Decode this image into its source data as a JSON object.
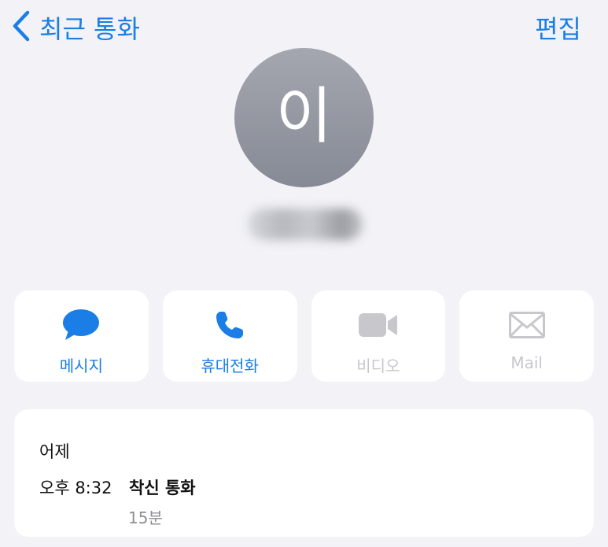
{
  "nav": {
    "back_label": "최근 통화",
    "edit_label": "편집"
  },
  "contact": {
    "initial": "이",
    "name_redacted": true
  },
  "actions": [
    {
      "label": "메시지",
      "icon": "message-bubble-icon",
      "enabled": true
    },
    {
      "label": "휴대전화",
      "icon": "phone-icon",
      "enabled": true
    },
    {
      "label": "비디오",
      "icon": "video-camera-icon",
      "enabled": false
    },
    {
      "label": "Mail",
      "icon": "envelope-icon",
      "enabled": false
    }
  ],
  "call_log": {
    "day": "어제",
    "time": "오후 8:32",
    "type": "착신 통화",
    "duration": "15분"
  },
  "colors": {
    "accent": "#1a7ee6",
    "background": "#f2f2f7",
    "disabled": "#c7c7cc",
    "avatar": "#8f929b"
  }
}
